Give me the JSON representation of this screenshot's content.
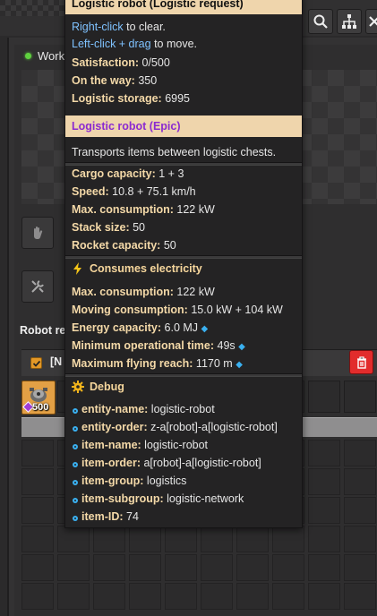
{
  "toolbar": {
    "search_icon": "search-icon",
    "network_icon": "network-icon",
    "close_icon": "close-icon"
  },
  "status": {
    "text": "Work",
    "color": "#5fd13f"
  },
  "robot_requests": {
    "section_title": "Robot re",
    "request_name": "[N",
    "slot_count": "500"
  },
  "tooltip": {
    "header1": "Logistic robot (Logistic request)",
    "hint_right_click": "Right-click",
    "hint_right_click_rest": " to clear.",
    "hint_left_click": "Left-click + drag",
    "hint_left_click_rest": " to move.",
    "satisfaction_label": "Satisfaction:",
    "satisfaction_value": " 0/500",
    "on_the_way_label": "On the way:",
    "on_the_way_value": " 350",
    "logistic_storage_label": "Logistic storage:",
    "logistic_storage_value": " 6995",
    "header2": "Logistic robot (Epic)",
    "description": "Transports items between logistic chests.",
    "cargo_label": "Cargo capacity:",
    "cargo_value": " 1 + 3",
    "speed_label": "Speed:",
    "speed_value": " 10.8 + 75.1 km/h",
    "maxcons_label": "Max. consumption:",
    "maxcons_value": " 122 kW",
    "stack_label": "Stack size:",
    "stack_value": " 50",
    "rocket_label": "Rocket capacity:",
    "rocket_value": " 50",
    "electric_title": "Consumes electricity",
    "e_maxcons_label": "Max. consumption:",
    "e_maxcons_value": " 122 kW",
    "moving_label": "Moving consumption:",
    "moving_value": " 15.0 kW + 104 kW",
    "energy_label": "Energy capacity:",
    "energy_value": " 6.0 MJ",
    "min_op_label": "Minimum operational time:",
    "min_op_value": " 49s",
    "max_reach_label": "Maximum flying reach:",
    "max_reach_value": " 1170 m",
    "debug_title": "Debug",
    "debug": [
      {
        "label": "entity-name:",
        "value": " logistic-robot"
      },
      {
        "label": "entity-order:",
        "value": " z-a[robot]-a[logistic-robot]"
      },
      {
        "label": "item-name:",
        "value": " logistic-robot"
      },
      {
        "label": "item-order:",
        "value": " a[robot]-a[logistic-robot]"
      },
      {
        "label": "item-group:",
        "value": " logistics"
      },
      {
        "label": "item-subgroup:",
        "value": " logistic-network"
      },
      {
        "label": "item-ID:",
        "value": " 74"
      }
    ]
  },
  "colors": {
    "header_bg": "#efd5ac",
    "epic": "#8b2ad0",
    "link": "#7fc2ff",
    "label": "#f4d9a8",
    "trash": "#e22c2c",
    "checkbox": "#e39827"
  }
}
